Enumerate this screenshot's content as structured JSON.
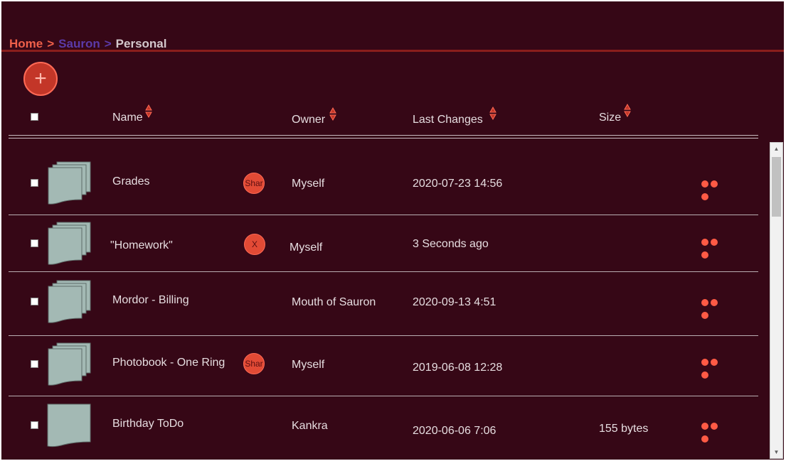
{
  "breadcrumb": {
    "home": "Home",
    "sauron": "Sauron",
    "current": "Personal",
    "separator": ">"
  },
  "add_button": {
    "icon": "plus-icon",
    "label": "+"
  },
  "columns": {
    "name": "Name",
    "owner": "Owner",
    "last_changes": "Last Changes",
    "size": "Size"
  },
  "rows": [
    {
      "name": "Grades",
      "badge": "Shar",
      "owner": "Myself",
      "last_changes": "2020-07-23 14:56",
      "size": "",
      "icon": "folder-stack-icon"
    },
    {
      "name": "\"Homework\"",
      "badge": "X",
      "owner": "Myself",
      "last_changes": "3 Seconds ago",
      "size": "",
      "icon": "folder-stack-icon"
    },
    {
      "name": "Mordor - Billing",
      "badge": "",
      "owner": "Mouth of Sauron",
      "last_changes": "2020-09-13 4:51",
      "size": "",
      "icon": "folder-stack-icon"
    },
    {
      "name": "Photobook - One Ring",
      "badge": "Shar",
      "owner": "Myself",
      "last_changes": "2019-06-08 12:28",
      "size": "",
      "icon": "folder-stack-icon"
    },
    {
      "name": "Birthday ToDo",
      "badge": "",
      "owner": "Kankra",
      "last_changes": "2020-06-06 7:06",
      "size": "155 bytes",
      "icon": "file-icon"
    }
  ],
  "colors": {
    "background": "#360716",
    "accent": "#ff5a45",
    "breadcrumb_link": "#5b3aa8",
    "file_fill": "#a3b9b4"
  }
}
